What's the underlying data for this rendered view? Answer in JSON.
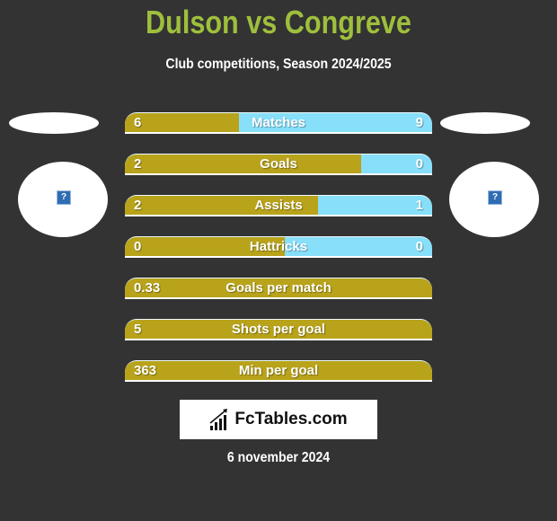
{
  "header": {
    "title": "Dulson vs Congreve",
    "subtitle": "Club competitions, Season 2024/2025"
  },
  "teams": {
    "left": {
      "name": "Dulson",
      "logo_icon": "broken-image-icon",
      "logo_glyph": "?"
    },
    "right": {
      "name": "Congreve",
      "logo_icon": "broken-image-icon",
      "logo_glyph": "?"
    }
  },
  "colors": {
    "background": "#333333",
    "title": "#9ebf3c",
    "left_bar": "#b8a31b",
    "right_bar": "#87dffa",
    "text": "#ffffff"
  },
  "stats": [
    {
      "label": "Matches",
      "left": "6",
      "right": "9",
      "left_share": 0.37
    },
    {
      "label": "Goals",
      "left": "2",
      "right": "0",
      "left_share": 0.77
    },
    {
      "label": "Assists",
      "left": "2",
      "right": "1",
      "left_share": 0.63
    },
    {
      "label": "Hattricks",
      "left": "0",
      "right": "0",
      "left_share": 0.52
    },
    {
      "label": "Goals per match",
      "left": "0.33",
      "right": "",
      "left_share": 1.0
    },
    {
      "label": "Shots per goal",
      "left": "5",
      "right": "",
      "left_share": 1.0
    },
    {
      "label": "Min per goal",
      "left": "363",
      "right": "",
      "left_share": 1.0
    }
  ],
  "footer": {
    "brand": "FcTables.com",
    "brand_icon": "bar-chart-icon",
    "date": "6 november 2024"
  }
}
